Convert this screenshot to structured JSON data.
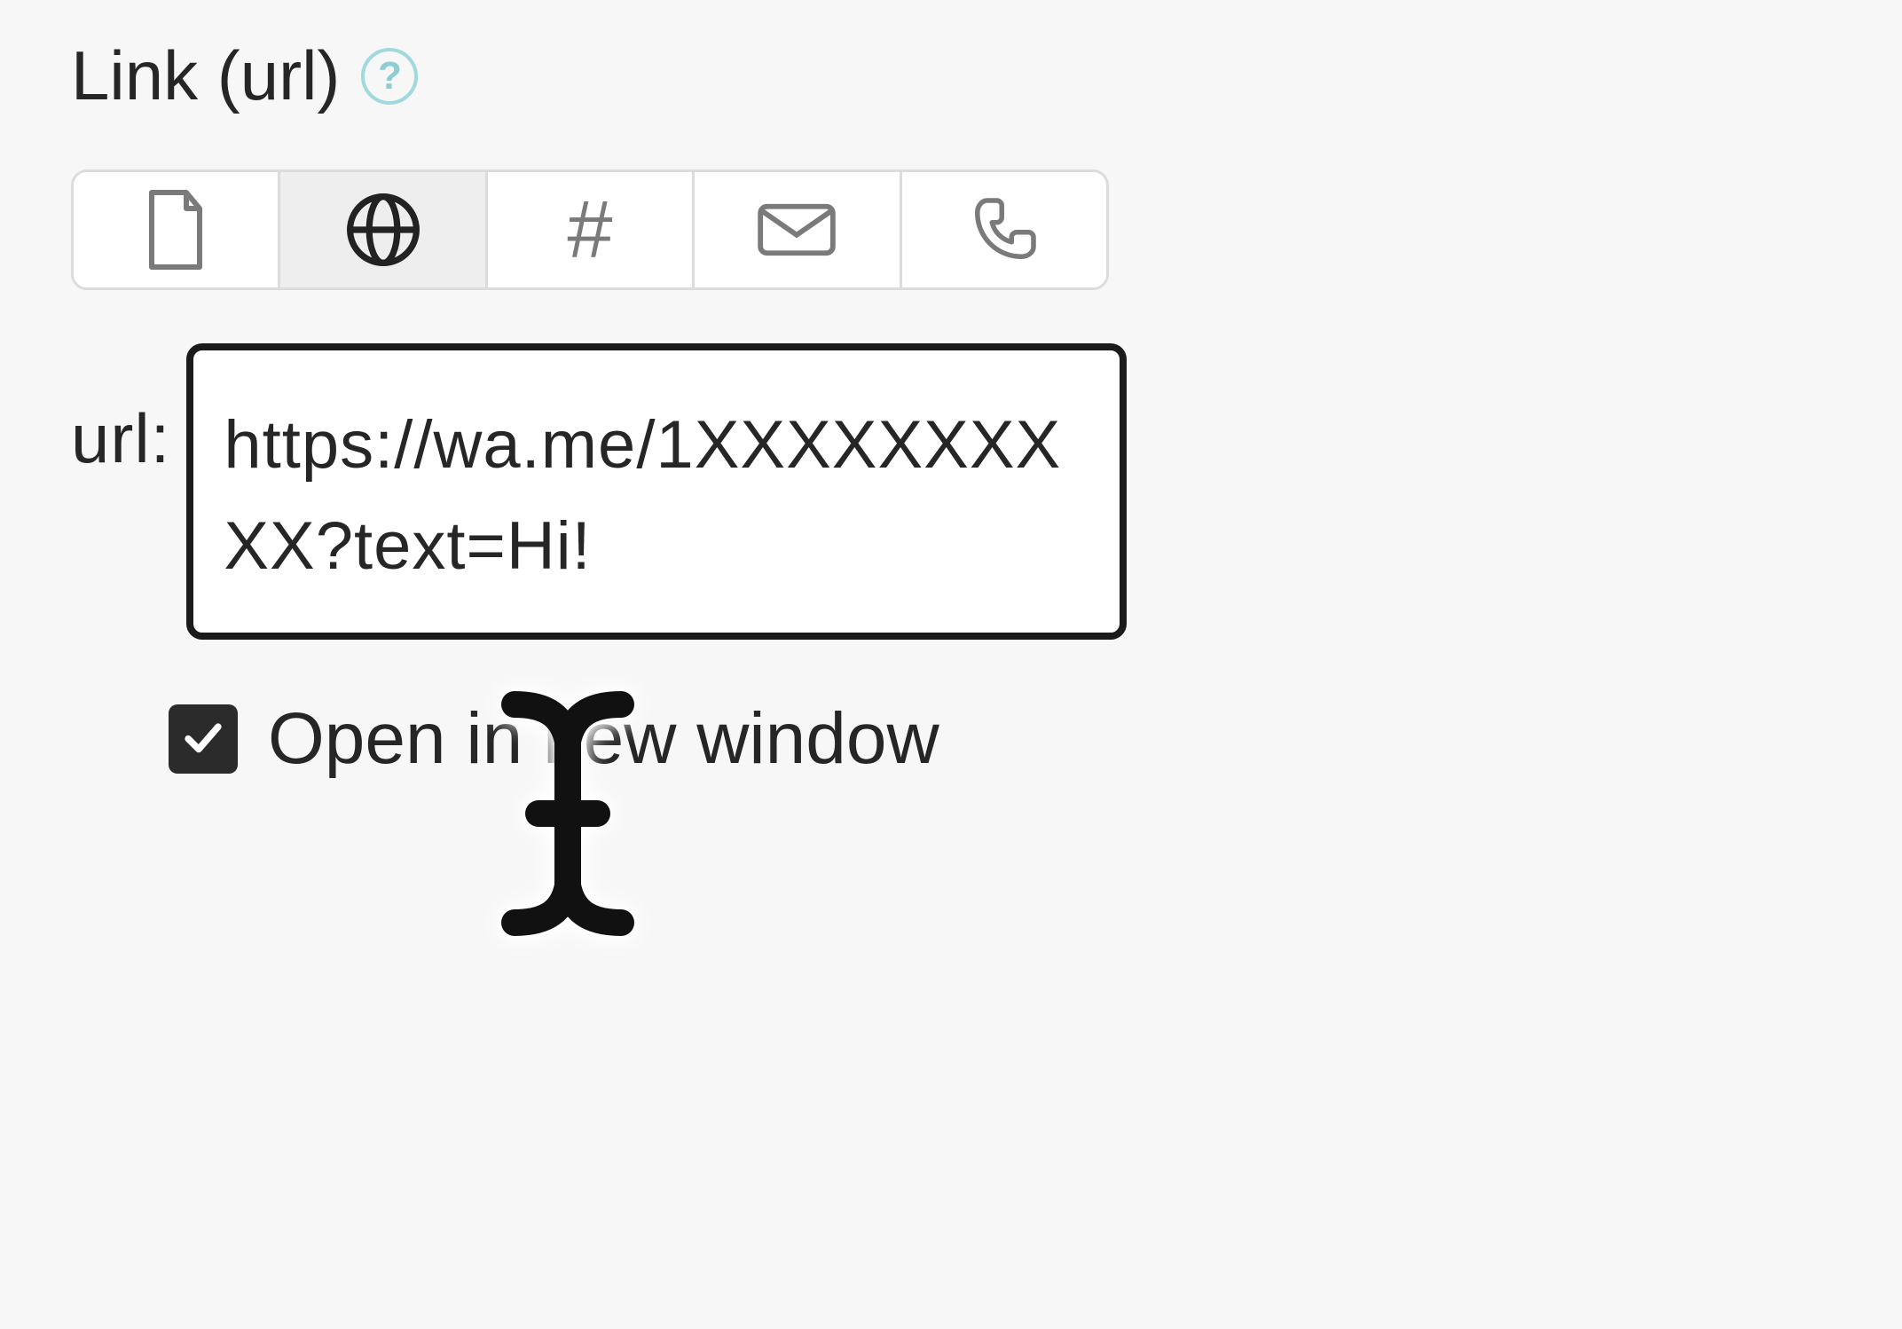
{
  "header": {
    "title": "Link (url)",
    "help_symbol": "?"
  },
  "tabs": {
    "items": [
      {
        "name": "page-icon"
      },
      {
        "name": "globe-icon"
      },
      {
        "name": "anchor-icon"
      },
      {
        "name": "mail-icon"
      },
      {
        "name": "phone-icon"
      }
    ],
    "active_index": 1,
    "anchor_glyph": "#"
  },
  "url_field": {
    "label": "url:",
    "value": "https://wa.me/1XXXXXXXXXX?text=Hi!"
  },
  "open_new_window": {
    "label": "Open in new window",
    "checked": true
  }
}
